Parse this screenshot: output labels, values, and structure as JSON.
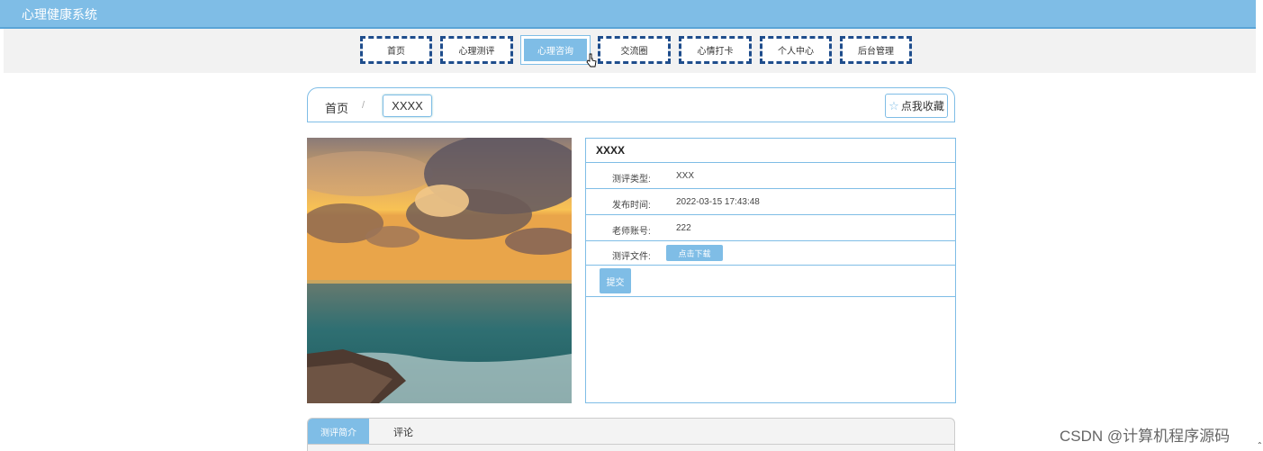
{
  "app": {
    "title": "心理健康系统"
  },
  "nav": {
    "items": [
      {
        "label": "首页",
        "active": false
      },
      {
        "label": "心理测评",
        "active": false
      },
      {
        "label": "心理咨询",
        "active": true
      },
      {
        "label": "交流圈",
        "active": false
      },
      {
        "label": "心情打卡",
        "active": false
      },
      {
        "label": "个人中心",
        "active": false
      },
      {
        "label": "后台管理",
        "active": false
      }
    ]
  },
  "breadcrumb": {
    "home": "首页",
    "separator": "/",
    "current": "XXXX"
  },
  "favorite": {
    "label": "点我收藏"
  },
  "detail": {
    "title": "XXXX",
    "fields": [
      {
        "label": "测评类型:",
        "value": "XXX"
      },
      {
        "label": "发布时间:",
        "value": "2022-03-15 17:43:48"
      },
      {
        "label": "老师账号:",
        "value": "222"
      }
    ],
    "file": {
      "label": "测评文件:",
      "button": "点击下载"
    },
    "submit_label": "提交"
  },
  "tabs": [
    {
      "label": "测评简介",
      "active": true
    },
    {
      "label": "评论",
      "active": false
    }
  ],
  "watermark": "CSDN @计算机程序源码",
  "colors": {
    "accent": "#7fbde6",
    "nav_border": "#1f4d8c"
  }
}
